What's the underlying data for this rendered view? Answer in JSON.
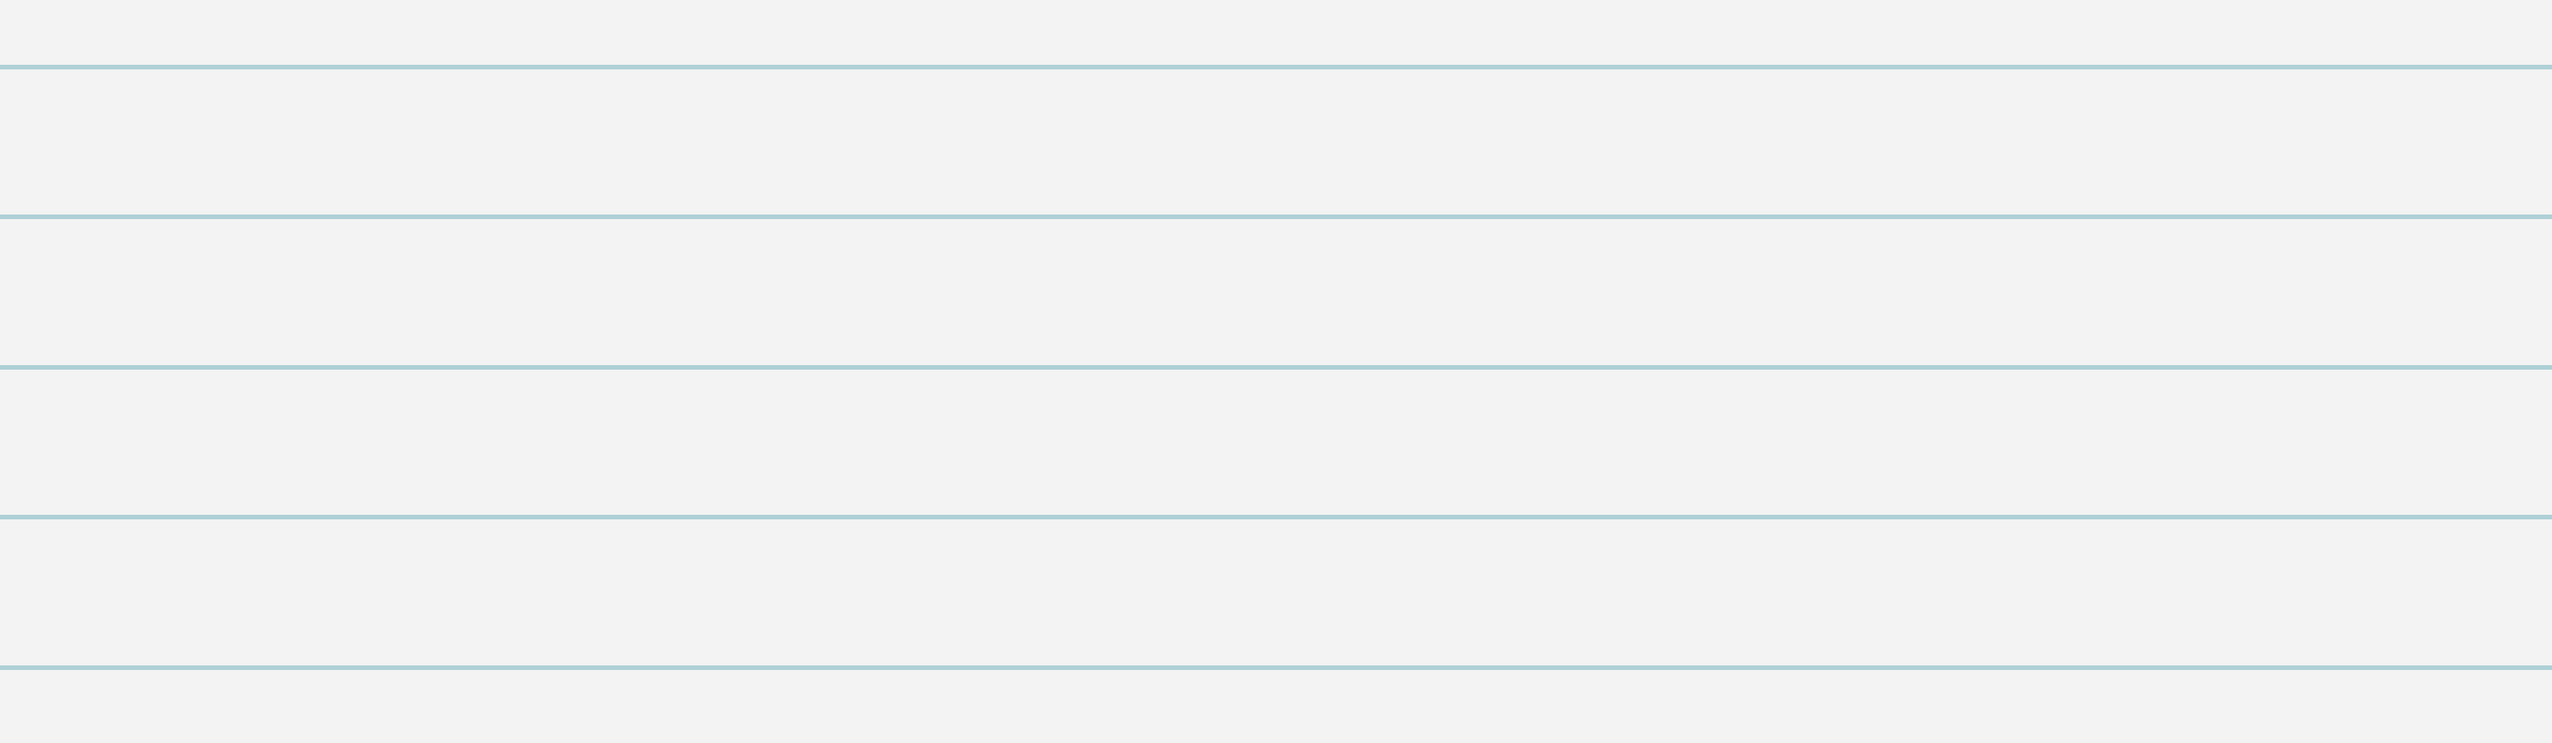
{
  "page": {
    "background_color": "#f2f3f2",
    "rule_color": "#aed0d6"
  }
}
